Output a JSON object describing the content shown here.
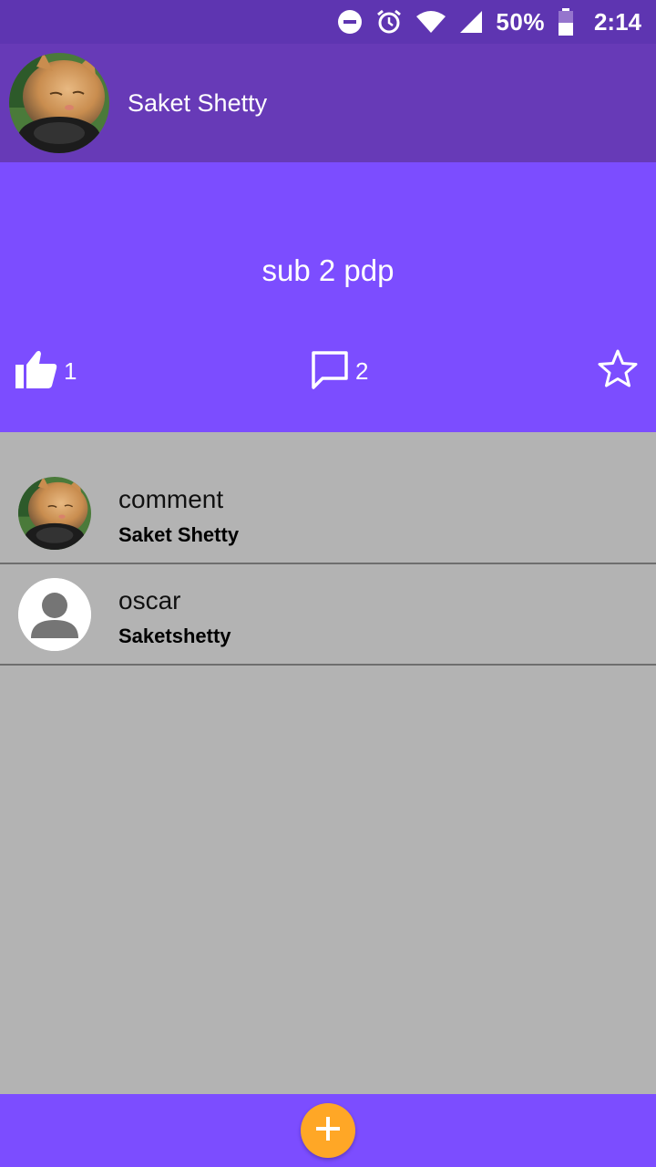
{
  "status_bar": {
    "battery": "50%",
    "time": "2:14",
    "icons": [
      "dnd-icon",
      "alarm-icon",
      "wifi-icon",
      "signal-icon",
      "battery-icon"
    ]
  },
  "profile": {
    "name": "Saket Shetty",
    "avatar_icon": "cat-photo-avatar"
  },
  "post": {
    "text": "sub 2 pdp",
    "likes": "1",
    "comments": "2",
    "icons": {
      "like": "thumb-up-icon",
      "comment": "comment-bubble-icon",
      "favorite": "star-outline-icon"
    }
  },
  "comments": [
    {
      "text": "comment",
      "author": "Saket Shetty",
      "avatar_icon": "cat-photo-avatar"
    },
    {
      "text": "oscar",
      "author": "Saketshetty",
      "avatar_icon": "default-person-avatar"
    }
  ],
  "fab": {
    "icon": "plus-icon"
  },
  "colors": {
    "status_bar": "#5e35b1",
    "header": "#673ab7",
    "accent": "#7c4dff",
    "list_background": "#b3b3b3",
    "fab": "#ffa726"
  }
}
